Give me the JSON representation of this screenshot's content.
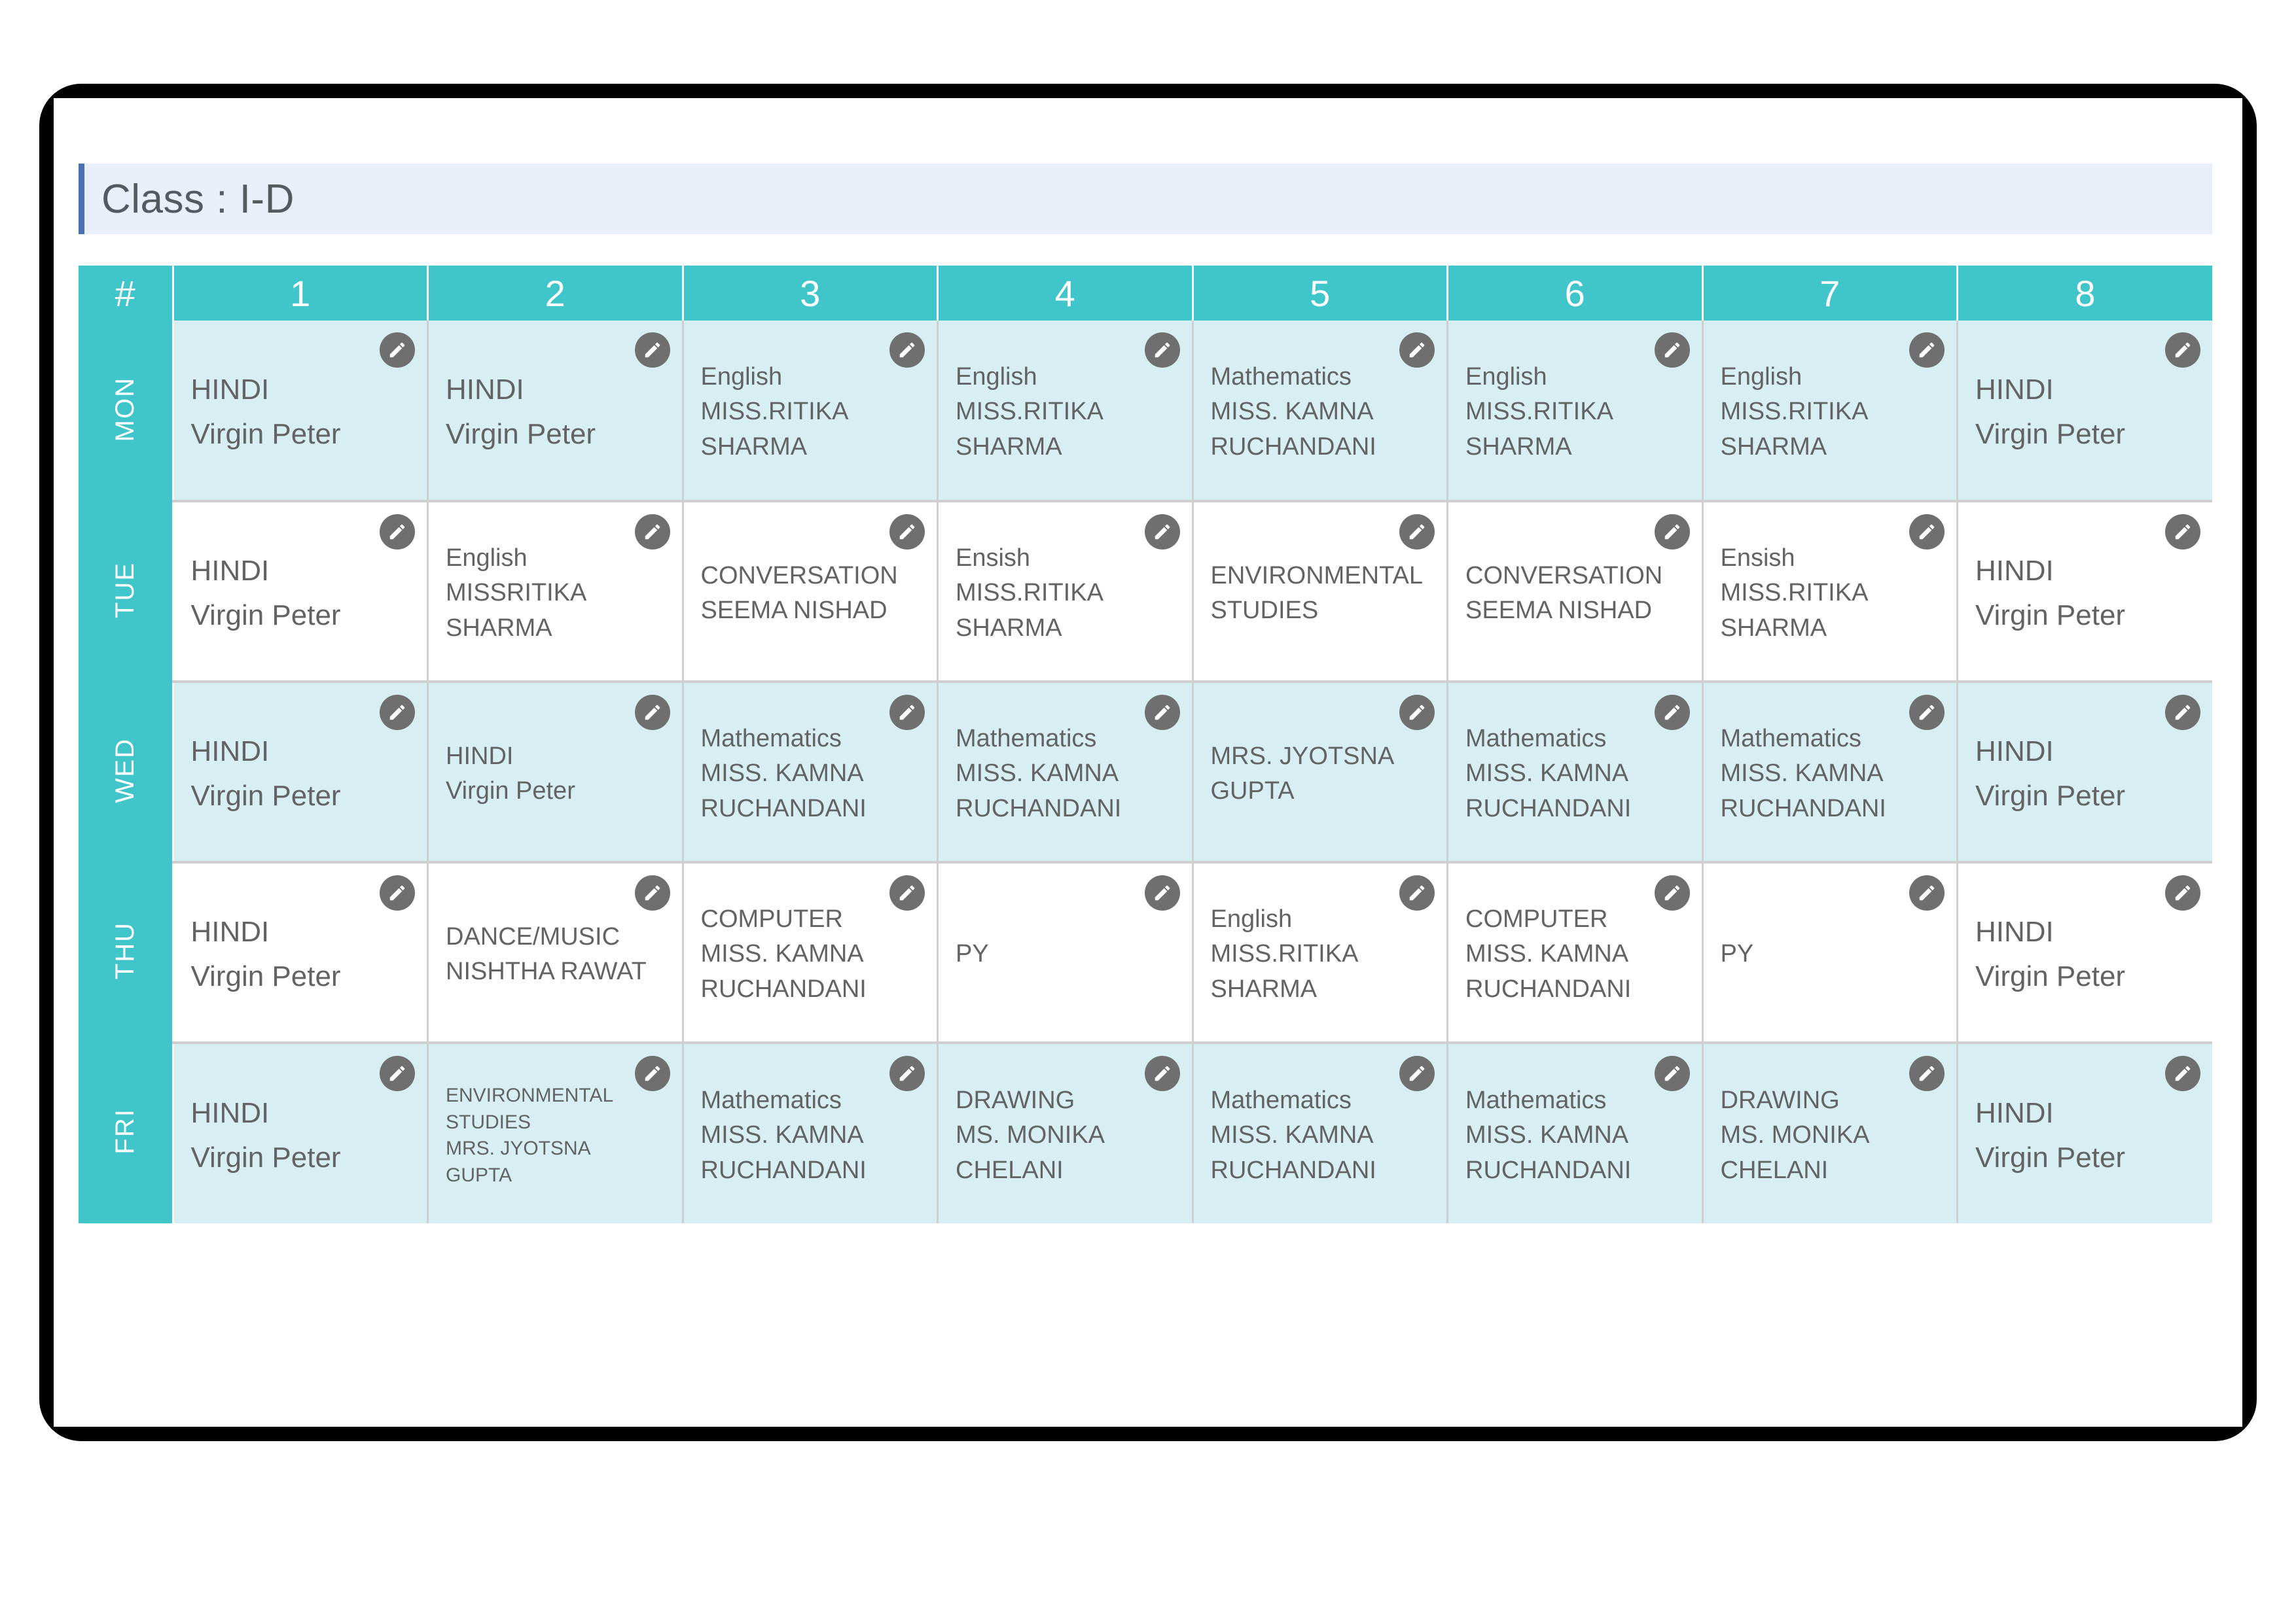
{
  "banner": {
    "title": "Class : I-D",
    "accent_color": "#4a6fb5",
    "background_color": "#e9eff9"
  },
  "theme": {
    "header_color": "#40c6ca",
    "tinted_row_color": "#d7eff2",
    "plain_row_color": "#ffffff",
    "text_color": "#636363"
  },
  "table": {
    "corner_header": "#",
    "period_headers": [
      "1",
      "2",
      "3",
      "4",
      "5",
      "6",
      "7",
      "8"
    ],
    "edit_icon": "pencil-icon",
    "rows": [
      {
        "day": "MON",
        "tint": true,
        "slots": [
          {
            "size": "lg",
            "lines": [
              "HINDI",
              "Virgin Peter"
            ]
          },
          {
            "size": "lg",
            "lines": [
              "HINDI",
              "Virgin Peter"
            ]
          },
          {
            "size": "md",
            "lines": [
              "English",
              "MISS.RITIKA",
              "SHARMA"
            ]
          },
          {
            "size": "md",
            "lines": [
              "English",
              "MISS.RITIKA",
              "SHARMA"
            ]
          },
          {
            "size": "md",
            "lines": [
              "Mathematics",
              "MISS. KAMNA",
              "RUCHANDANI"
            ]
          },
          {
            "size": "md",
            "lines": [
              "English",
              "MISS.RITIKA",
              "SHARMA"
            ]
          },
          {
            "size": "md",
            "lines": [
              "English",
              "MISS.RITIKA",
              "SHARMA"
            ]
          },
          {
            "size": "lg",
            "lines": [
              "HINDI",
              "Virgin Peter"
            ]
          }
        ]
      },
      {
        "day": "TUE",
        "tint": false,
        "slots": [
          {
            "size": "lg",
            "lines": [
              "HINDI",
              "Virgin Peter"
            ]
          },
          {
            "size": "md",
            "lines": [
              "English",
              "MISSRITIKA",
              "SHARMA"
            ]
          },
          {
            "size": "md",
            "lines": [
              "CONVERSATION",
              "SEEMA NISHAD"
            ]
          },
          {
            "size": "md",
            "lines": [
              "Ensish",
              "MISS.RITIKA",
              "SHARMA"
            ]
          },
          {
            "size": "md",
            "lines": [
              "ENVIRONMENTAL",
              "STUDIES"
            ]
          },
          {
            "size": "md",
            "lines": [
              "CONVERSATION",
              "SEEMA NISHAD"
            ]
          },
          {
            "size": "md",
            "lines": [
              "Ensish",
              "MISS.RITIKA",
              "SHARMA"
            ]
          },
          {
            "size": "lg",
            "lines": [
              "HINDI",
              "Virgin Peter"
            ]
          }
        ]
      },
      {
        "day": "WED",
        "tint": true,
        "slots": [
          {
            "size": "lg",
            "lines": [
              "HINDI",
              "Virgin Peter"
            ]
          },
          {
            "size": "md",
            "lines": [
              "HINDI",
              "Virgin Peter"
            ]
          },
          {
            "size": "md",
            "lines": [
              "Mathematics",
              "MISS. KAMNA",
              "RUCHANDANI"
            ]
          },
          {
            "size": "md",
            "lines": [
              "Mathematics",
              "MISS. KAMNA",
              "RUCHANDANI"
            ]
          },
          {
            "size": "md",
            "lines": [
              "MRS. JYOTSNA",
              "GUPTA"
            ]
          },
          {
            "size": "md",
            "lines": [
              "Mathematics",
              "MISS. KAMNA",
              "RUCHANDANI"
            ]
          },
          {
            "size": "md",
            "lines": [
              "Mathematics",
              "MISS. KAMNA",
              "RUCHANDANI"
            ]
          },
          {
            "size": "lg",
            "lines": [
              "HINDI",
              "Virgin Peter"
            ]
          }
        ]
      },
      {
        "day": "THU",
        "tint": false,
        "slots": [
          {
            "size": "lg",
            "lines": [
              "HINDI",
              "Virgin Peter"
            ]
          },
          {
            "size": "md",
            "lines": [
              "DANCE/MUSIC",
              "NISHTHA RAWAT"
            ]
          },
          {
            "size": "md",
            "lines": [
              "COMPUTER",
              "MISS. KAMNA",
              "RUCHANDANI"
            ]
          },
          {
            "size": "md",
            "lines": [
              "PY"
            ]
          },
          {
            "size": "md",
            "lines": [
              "English",
              "MISS.RITIKA",
              "SHARMA"
            ]
          },
          {
            "size": "md",
            "lines": [
              "COMPUTER",
              "MISS. KAMNA",
              "RUCHANDANI"
            ]
          },
          {
            "size": "md",
            "lines": [
              "PY"
            ]
          },
          {
            "size": "lg",
            "lines": [
              "HINDI",
              "Virgin Peter"
            ]
          }
        ]
      },
      {
        "day": "FRI",
        "tint": true,
        "slots": [
          {
            "size": "lg",
            "lines": [
              "HINDI",
              "Virgin Peter"
            ]
          },
          {
            "size": "sm",
            "lines": [
              "ENVIRONMENTAL",
              "STUDIES",
              "MRS. JYOTSNA",
              "GUPTA"
            ]
          },
          {
            "size": "md",
            "lines": [
              "Mathematics",
              "MISS. KAMNA",
              "RUCHANDANI"
            ]
          },
          {
            "size": "md",
            "lines": [
              "DRAWING",
              "MS. MONIKA",
              "CHELANI"
            ]
          },
          {
            "size": "md",
            "lines": [
              "Mathematics",
              "MISS. KAMNA",
              "RUCHANDANI"
            ]
          },
          {
            "size": "md",
            "lines": [
              "Mathematics",
              "MISS. KAMNA",
              "RUCHANDANI"
            ]
          },
          {
            "size": "md",
            "lines": [
              "DRAWING",
              "MS. MONIKA",
              "CHELANI"
            ]
          },
          {
            "size": "lg",
            "lines": [
              "HINDI",
              "Virgin Peter"
            ]
          }
        ]
      }
    ]
  }
}
